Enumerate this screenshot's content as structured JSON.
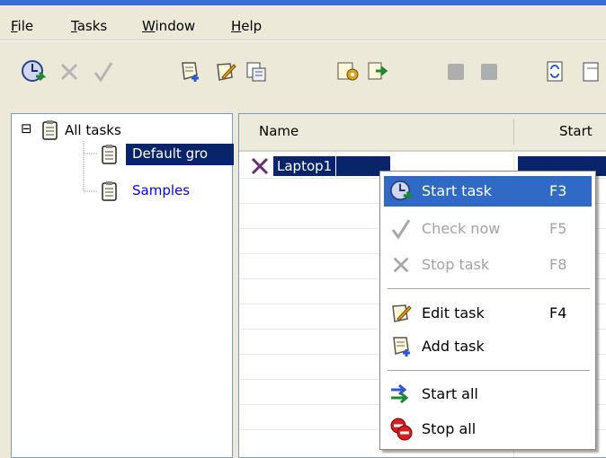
{
  "menubar": {
    "items": [
      {
        "label": "File",
        "mnemonic": "F",
        "rest": "ile"
      },
      {
        "label": "Tasks",
        "mnemonic": "T",
        "rest": "asks"
      },
      {
        "label": "Window",
        "mnemonic": "W",
        "rest": "indow"
      },
      {
        "label": "Help",
        "mnemonic": "H",
        "rest": "elp"
      }
    ]
  },
  "toolbar": {
    "icons": [
      "clock-start-icon",
      "cross-stop-icon",
      "check-icon",
      "add-task-icon",
      "edit-task-icon",
      "properties-icon",
      "settings-icon",
      "export-icon",
      "gray-square-icon",
      "gray-square-icon",
      "refresh-icon"
    ]
  },
  "tree": {
    "root_label": "All tasks",
    "expander": "⊟",
    "children": [
      {
        "label": "Default gro",
        "selected": true
      },
      {
        "label": "Samples",
        "selected": false
      }
    ]
  },
  "list": {
    "columns": [
      "Name",
      "Start"
    ],
    "rows": [
      {
        "name": "Laptop1",
        "status_icon": "red-cross-icon"
      }
    ]
  },
  "context_menu": {
    "items": [
      {
        "label": "Start task",
        "shortcut": "F3",
        "icon": "clock-start-icon",
        "highlighted": true,
        "disabled": false
      },
      {
        "label": "Check now",
        "shortcut": "F5",
        "icon": "check-icon",
        "highlighted": false,
        "disabled": true
      },
      {
        "label": "Stop task",
        "shortcut": "F8",
        "icon": "cross-stop-icon",
        "highlighted": false,
        "disabled": true
      },
      {
        "label": "Edit task",
        "shortcut": "F4",
        "icon": "edit-task-icon",
        "highlighted": false,
        "disabled": false
      },
      {
        "label": "Add task",
        "shortcut": "",
        "icon": "add-task-icon",
        "highlighted": false,
        "disabled": false
      },
      {
        "label": "Start all",
        "shortcut": "",
        "icon": "start-all-icon",
        "highlighted": false,
        "disabled": false
      },
      {
        "label": "Stop all",
        "shortcut": "",
        "icon": "stop-all-icon",
        "highlighted": false,
        "disabled": false
      }
    ]
  },
  "colors": {
    "selection": "#0a246a",
    "menu_highlight": "#316ac5",
    "tree_link": "#0000ff",
    "stop_red": "#d42020",
    "disabled": "#a3a3a3"
  }
}
